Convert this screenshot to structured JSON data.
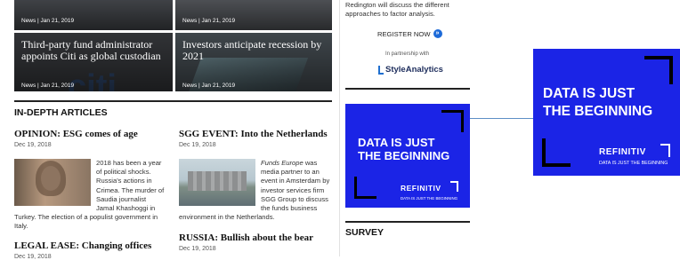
{
  "top_tiles": [
    {
      "meta": "News | Jan 21, 2019"
    },
    {
      "meta": "News | Jan 21, 2019"
    }
  ],
  "tiles": [
    {
      "title": "Third-party fund administrator appoints Citi as global custodian",
      "meta": "News | Jan 21, 2019"
    },
    {
      "title": "Investors anticipate recession by 2021",
      "meta": "News | Jan 21, 2019"
    }
  ],
  "in_depth": {
    "heading": "IN-DEPTH ARTICLES",
    "articles": [
      {
        "title": "OPINION: ESG comes of age",
        "date": "Dec 19, 2018",
        "body": "2018 has been a year of political shocks. Russia's actions in Crimea. The murder of Saudia journalist Jamal Khashoggi in Turkey. The election of a populist government in Italy."
      },
      {
        "title": "SGG EVENT: Into the Netherlands",
        "date": "Dec 19, 2018",
        "body_em": "Funds Europe",
        "body": " was media partner to an event in Amsterdam by investor services firm SGG Group to discuss the funds business environment in the Netherlands."
      },
      {
        "title": "LEGAL EASE: Changing offices",
        "date": "Dec 19, 2018"
      },
      {
        "title": "RUSSIA: Bullish about the bear",
        "date": "Dec 19, 2018"
      }
    ]
  },
  "sidebar": {
    "webinar_text": "Redington will discuss the different approaches to factor analysis.",
    "register_label": "REGISTER NOW",
    "partnership_text": "In partnership with",
    "partner_name": "StyleAnalytics",
    "survey_heading": "SURVEY"
  },
  "ads": {
    "headline_line1": "DATA IS JUST",
    "headline_line2": "THE BEGINNING",
    "brand": "REFINITIV",
    "tagline": "DATA IS JUST THE BEGINNING",
    "color": "#1b24e6"
  }
}
